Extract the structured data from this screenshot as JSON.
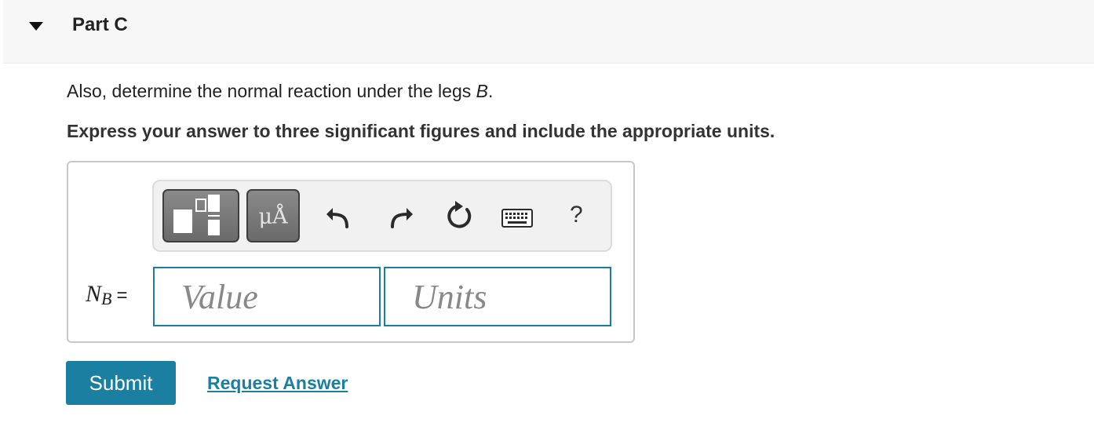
{
  "part": {
    "title": "Part C"
  },
  "question": {
    "text_prefix": "Also, determine the normal reaction under the legs ",
    "text_var": "B",
    "text_suffix": "."
  },
  "instruction": "Express your answer to three significant figures and include the appropriate units.",
  "toolbar": {
    "units_label": "μÅ",
    "help_label": "?",
    "icons": [
      "templates-icon",
      "units-icon",
      "undo-icon",
      "redo-icon",
      "reset-icon",
      "keyboard-icon",
      "help-icon"
    ]
  },
  "answer": {
    "variable": "N",
    "subscript": "B",
    "equals": "=",
    "value_placeholder": "Value",
    "units_placeholder": "Units"
  },
  "actions": {
    "submit_label": "Submit",
    "request_label": "Request Answer"
  },
  "colors": {
    "accent": "#1a7fa0",
    "header_bg": "#f7f7f7",
    "toolbar_button": "#777777"
  }
}
